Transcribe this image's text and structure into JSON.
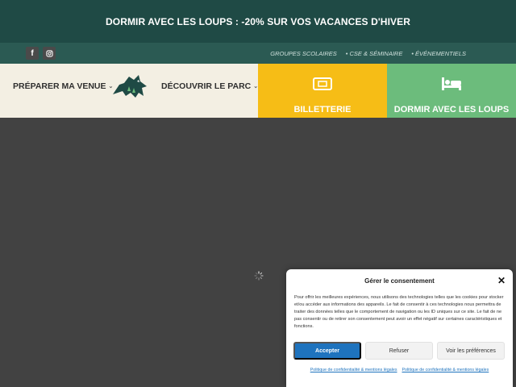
{
  "promo": {
    "text": "DORMIR AVEC LES LOUPS : -20% SUR VOS VACANCES D'HIVER"
  },
  "social": [
    {
      "icon": "facebook-icon",
      "glyph": "f"
    },
    {
      "icon": "instagram-icon",
      "glyph": "◎"
    }
  ],
  "sublinks": [
    "GROUPES SCOLAIRES",
    "• CSE & SÉMINAIRE",
    "• ÉVÉNEMENTIELS"
  ],
  "nav": {
    "prepare": "PRÉPARER MA VENUE",
    "discover": "DÉCOUVRIR LE PARC",
    "ticketing": "BILLETTERIE",
    "sleep": "DORMIR AVEC LES LOUPS"
  },
  "consent": {
    "title": "Gérer le consentement",
    "body": "Pour offrir les meilleures expériences, nous utilisons des technologies telles que les cookies pour stocker et/ou accéder aux informations des appareils. Le fait de consentir à ces technologies nous permettra de traiter des données telles que le comportement de navigation ou les ID uniques sur ce site. Le fait de ne pas consentir ou de retirer son consentement peut avoir un effet négatif sur certaines caractéristiques et fonctions.",
    "accept": "Accepter",
    "refuse": "Refuser",
    "preferences": "Voir les préférences",
    "links": [
      "Politique de confidentialité & mentions légales",
      "Politique de confidentialité & mentions légales"
    ]
  },
  "colors": {
    "promo_bg": "#1f4a45",
    "subbar_bg": "#2b5a53",
    "nav_bg": "#f3efe3",
    "ticketing_bg": "#f6bd16",
    "sleep_bg": "#6cbc7c",
    "accept_bg": "#1e73be"
  }
}
